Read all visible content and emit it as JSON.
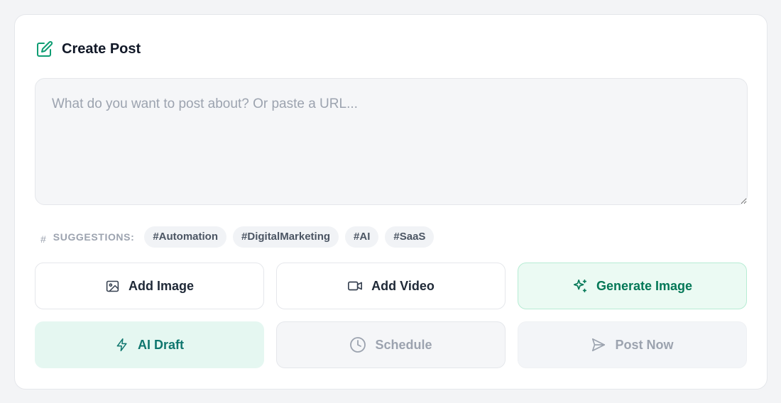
{
  "header": {
    "title": "Create Post",
    "icon": "edit-icon",
    "accent": "#0f9d73"
  },
  "composer": {
    "placeholder": "What do you want to post about? Or paste a URL...",
    "value": ""
  },
  "suggestions": {
    "label": "SUGGESTIONS:",
    "icon": "hash-icon",
    "tags": [
      "#Automation",
      "#DigitalMarketing",
      "#AI",
      "#SaaS"
    ]
  },
  "actions": {
    "add_image": {
      "label": "Add Image",
      "icon": "image-icon"
    },
    "add_video": {
      "label": "Add Video",
      "icon": "video-icon"
    },
    "generate_image": {
      "label": "Generate Image",
      "icon": "sparkles-icon"
    },
    "ai_draft": {
      "label": "AI Draft",
      "icon": "lightning-icon"
    },
    "schedule": {
      "label": "Schedule",
      "icon": "clock-icon"
    },
    "post_now": {
      "label": "Post Now",
      "icon": "send-icon"
    }
  }
}
